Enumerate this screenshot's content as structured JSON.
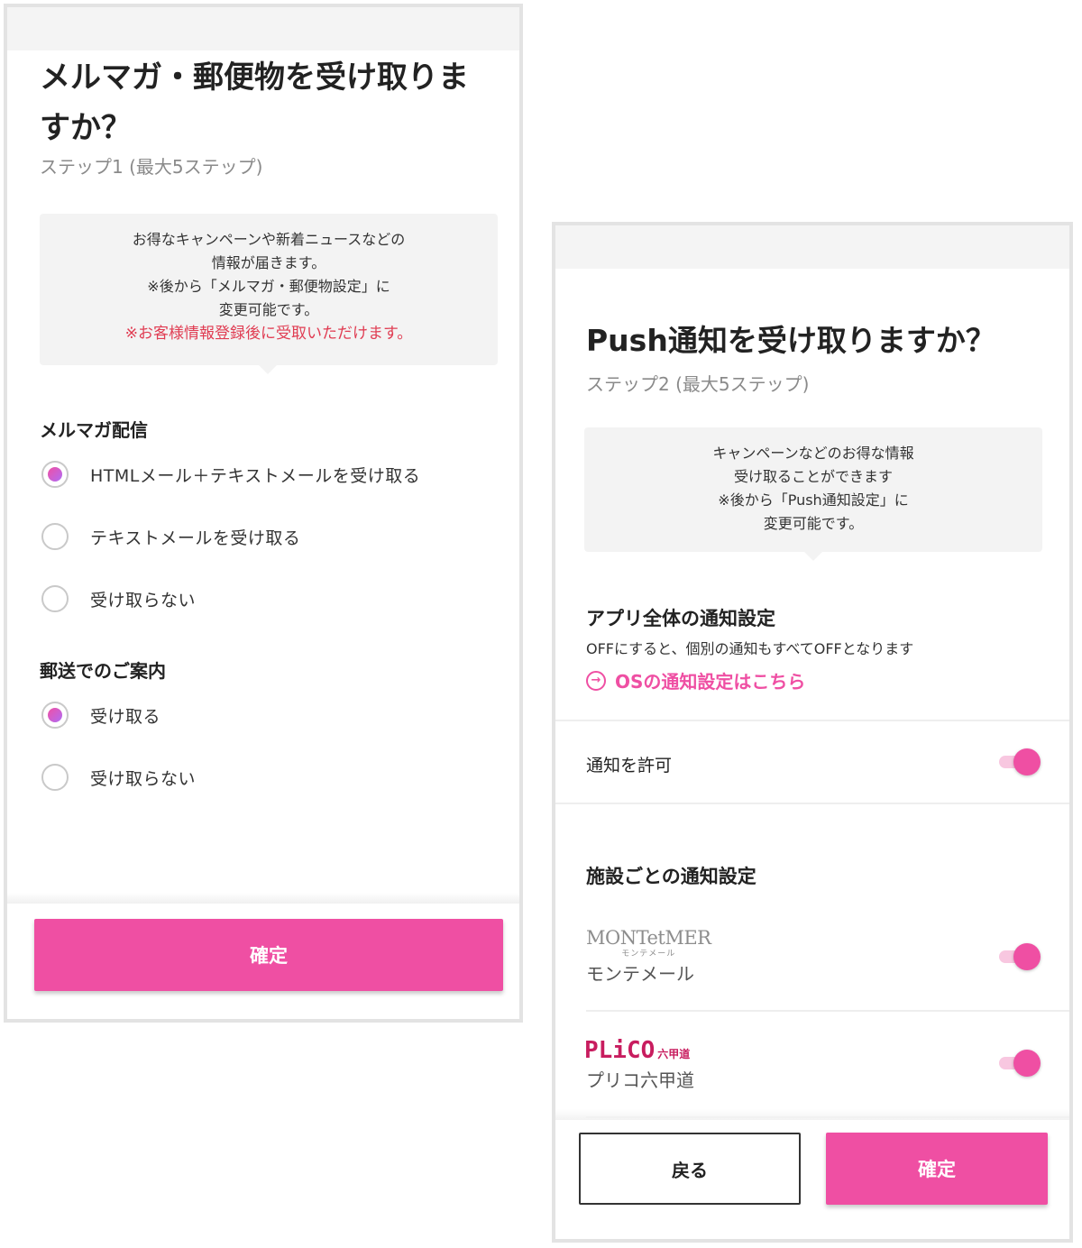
{
  "screen1": {
    "title_line1": "メルマガ・郵便物を受け取りま",
    "title_line2": "すか？",
    "step": "ステップ1 (最大5ステップ)",
    "info_lines": [
      "お得なキャンペーンや新着ニュースなどの",
      "情報が届きます。",
      "※後から「メルマガ・郵便物設定」に",
      "変更可能です。"
    ],
    "info_warning": "※お客様情報登録後に受取いただけます。",
    "mailmag": {
      "heading": "メルマガ配信",
      "options": [
        {
          "label": "HTMLメール＋テキストメールを受け取る",
          "selected": true
        },
        {
          "label": "テキストメールを受け取る",
          "selected": false
        },
        {
          "label": "受け取らない",
          "selected": false
        }
      ]
    },
    "postal": {
      "heading": "郵送でのご案内",
      "options": [
        {
          "label": "受け取る",
          "selected": true
        },
        {
          "label": "受け取らない",
          "selected": false
        }
      ]
    },
    "confirm_label": "確定"
  },
  "screen2": {
    "title": "Push通知を受け取りますか？",
    "step": "ステップ2 (最大5ステップ)",
    "info_lines": [
      "キャンペーンなどのお得な情報",
      "受け取ることができます",
      "※後から「Push通知設定」に",
      "変更可能です。"
    ],
    "app_section": {
      "heading": "アプリ全体の通知設定",
      "description": "OFFにすると、個別の通知もすべてOFFとなります",
      "os_link": "OSの通知設定はこちら",
      "allow_label": "通知を許可",
      "allow_on": true
    },
    "facility_section": {
      "heading": "施設ごとの通知設定",
      "facilities": [
        {
          "logo_text": "MONTetMER",
          "logo_sub": "モンテメール",
          "name": "モンテメール",
          "on": true
        },
        {
          "logo_text": "PLiCO",
          "logo_sub": "六甲道",
          "name": "プリコ六甲道",
          "on": true
        }
      ]
    },
    "back_label": "戻る",
    "confirm_label": "確定"
  },
  "colors": {
    "accent": "#ef4fa3",
    "warning": "#e03c52",
    "panel": "#f3f3f3",
    "plico": "#c81d5f"
  }
}
